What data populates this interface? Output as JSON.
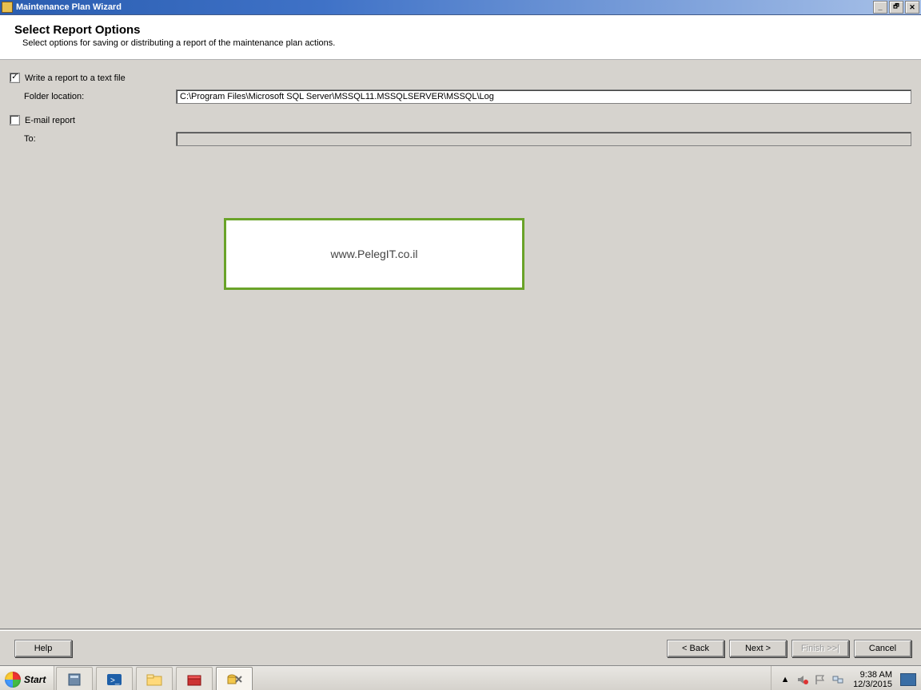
{
  "title_bar": {
    "title": "Maintenance Plan Wizard"
  },
  "header": {
    "title": "Select Report Options",
    "subtitle": "Select options for saving or distributing a report of the maintenance plan actions."
  },
  "form": {
    "write_report_label": "Write a report to a text file",
    "write_report_checked": true,
    "folder_location_label": "Folder location:",
    "folder_location_value": "C:\\Program Files\\Microsoft SQL Server\\MSSQL11.MSSQLSERVER\\MSSQL\\Log",
    "email_report_label": "E-mail report",
    "email_report_checked": false,
    "to_label": "To:",
    "to_value": ""
  },
  "watermark": {
    "text": "www.PelegIT.co.il"
  },
  "footer": {
    "help": "Help",
    "back": "< Back",
    "next": "Next >",
    "finish": "Finish >>|",
    "cancel": "Cancel"
  },
  "taskbar": {
    "start": "Start",
    "time": "9:38 AM",
    "date": "12/3/2015"
  }
}
